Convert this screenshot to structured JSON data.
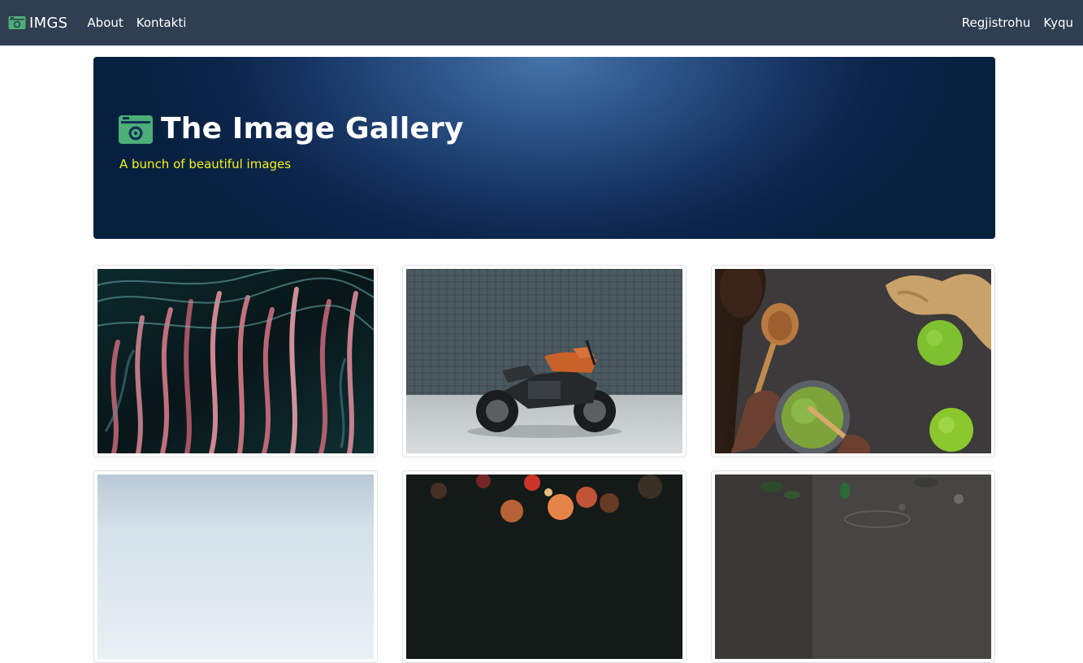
{
  "navbar": {
    "brand": "IMGS",
    "links": [
      "About",
      "Kontakti"
    ],
    "right_links": [
      "Regjistrohu",
      "Kyqu"
    ]
  },
  "hero": {
    "title": "The Image Gallery",
    "subtitle": "A bunch of beautiful images"
  },
  "gallery": {
    "images": [
      {
        "subject": "abstract light trails"
      },
      {
        "subject": "motorcycle by tiled wall"
      },
      {
        "subject": "matcha tea with wooden spoons and limes"
      },
      {
        "subject": "misty sky"
      },
      {
        "subject": "bokeh lights"
      },
      {
        "subject": "dark stone with leaves"
      }
    ]
  },
  "colors": {
    "navbar": "#2f3e51",
    "hero_subtitle": "#f5f51a",
    "icon_green": "#4caf78"
  }
}
